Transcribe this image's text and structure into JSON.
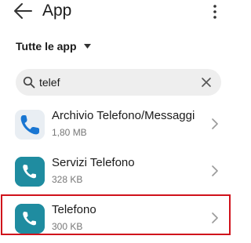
{
  "header": {
    "title": "App",
    "back_icon": "arrow-left-icon",
    "menu_icon": "vertical-dots-icon"
  },
  "filter": {
    "label": "Tutte le app",
    "icon": "caret-down-icon"
  },
  "search": {
    "value": "telef",
    "icon": "search-icon",
    "clear_icon": "close-icon"
  },
  "apps": [
    {
      "name": "Archivio Telefono/Messaggi",
      "size": "1,80 MB",
      "icon": "phone-archive-icon"
    },
    {
      "name": "Servizi Telefono",
      "size": "328 KB",
      "icon": "phone-services-icon"
    },
    {
      "name": "Telefono",
      "size": "300 KB",
      "icon": "phone-icon",
      "highlighted": true
    }
  ],
  "colors": {
    "icon_teal": "#1f8ca0",
    "highlight_border": "#d0121b",
    "search_background": "#eeeeee"
  }
}
